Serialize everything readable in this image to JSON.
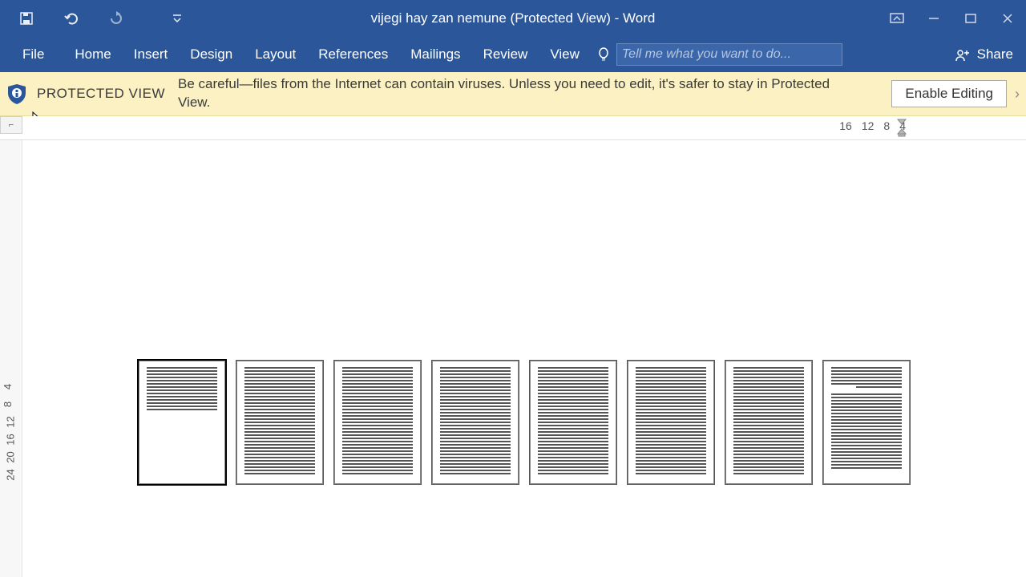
{
  "title": "vijegi hay zan nemune (Protected View) - Word",
  "ribbon": {
    "tabs": [
      "File",
      "Home",
      "Insert",
      "Design",
      "Layout",
      "References",
      "Mailings",
      "Review",
      "View"
    ],
    "tellme_placeholder": "Tell me what you want to do...",
    "share": "Share"
  },
  "protected": {
    "label": "PROTECTED VIEW",
    "message": "Be careful—files from the Internet can contain viruses. Unless you need to edit, it's safer to stay in Protected View.",
    "enable": "Enable Editing"
  },
  "ruler": {
    "h": [
      "16",
      "12",
      "8",
      "4"
    ],
    "v": [
      "4",
      "8",
      "12",
      "16",
      "20",
      "24"
    ]
  },
  "pages": {
    "count": 8,
    "selected": 0
  }
}
